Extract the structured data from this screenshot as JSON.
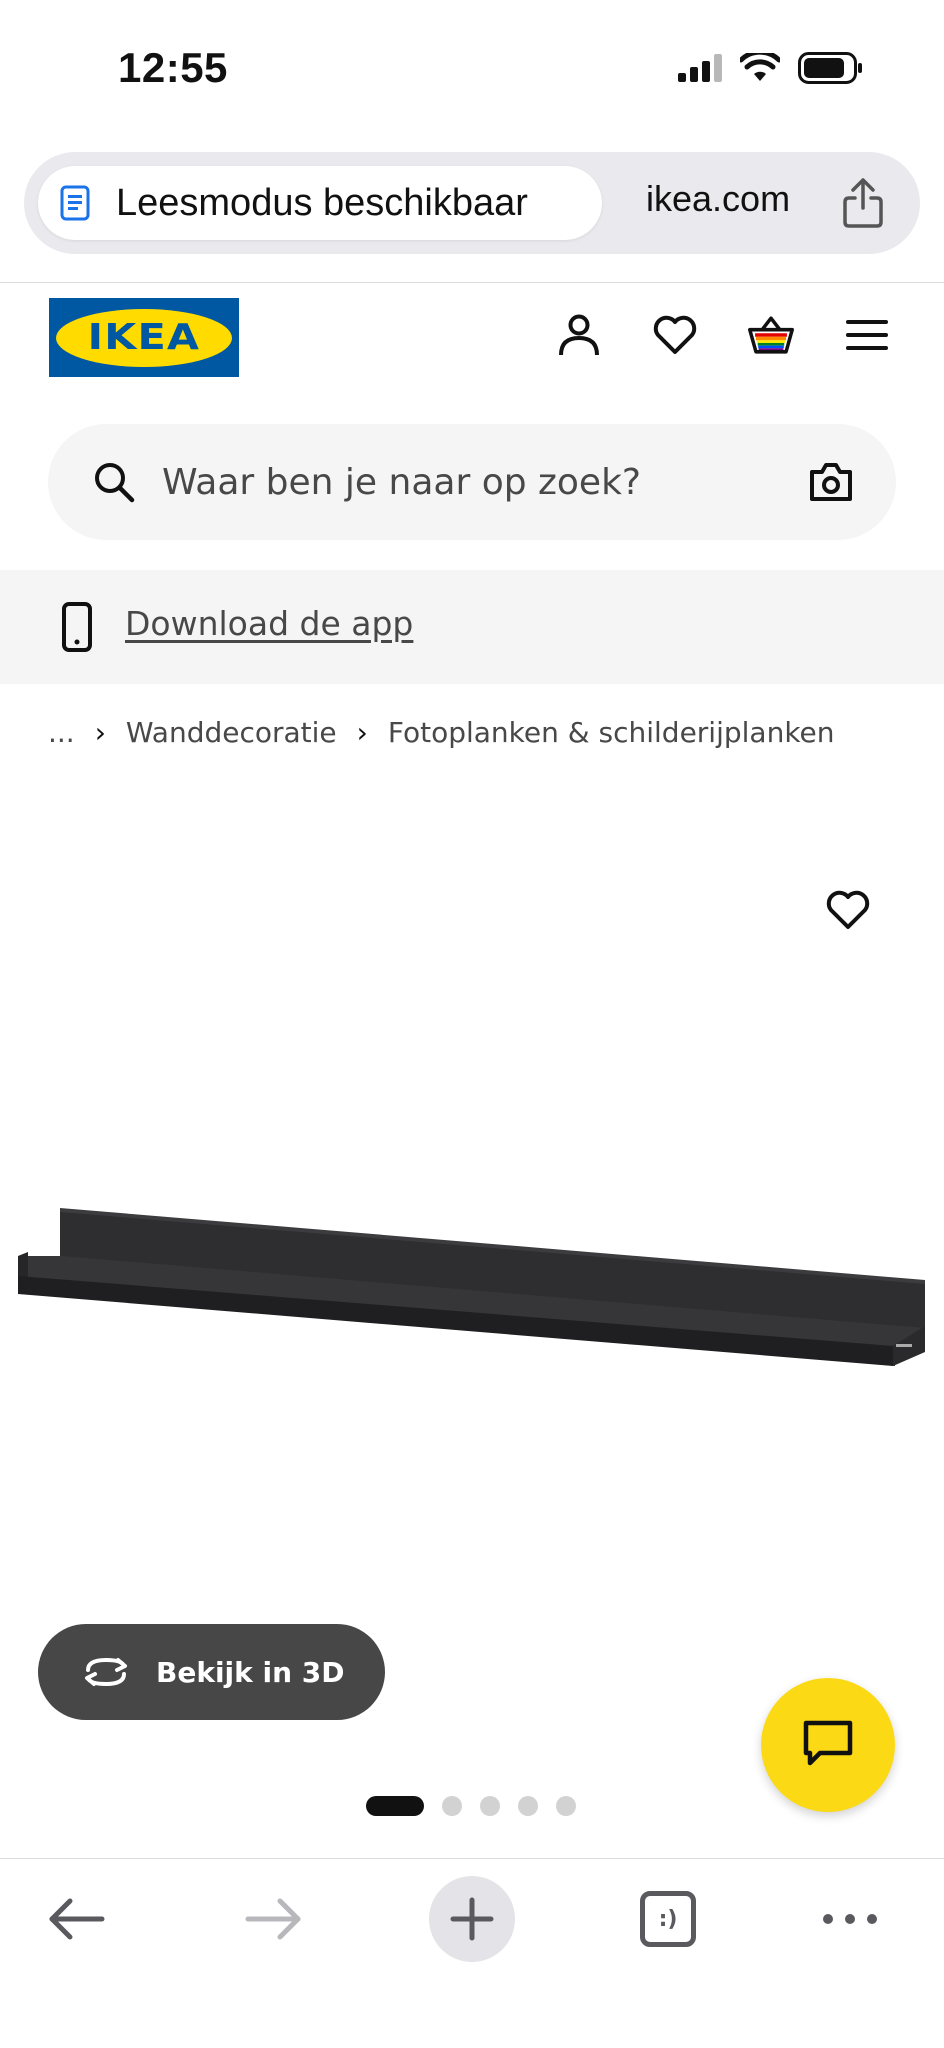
{
  "status_bar": {
    "time": "12:55"
  },
  "address_bar": {
    "reader_mode_label": "Leesmodus beschikbaar",
    "domain": "ikea.com"
  },
  "header": {
    "logo_text": "IKEA",
    "icons": [
      "user-icon",
      "heart-icon",
      "basket-icon",
      "menu-icon"
    ]
  },
  "search": {
    "placeholder": "Waar ben je naar op zoek?"
  },
  "app_banner": {
    "link_text": "Download de app"
  },
  "breadcrumb": {
    "items": [
      "...",
      "Wanddecoratie",
      "Fotoplanken & schilderijplanken"
    ]
  },
  "product": {
    "view_3d_label": "Bekijk in 3D",
    "image_count": 5,
    "active_image": 1
  },
  "colors": {
    "ikea_blue": "#0058a3",
    "ikea_yellow": "#ffdb00",
    "chat_yellow": "#fbd914",
    "button_dark": "#474747"
  }
}
